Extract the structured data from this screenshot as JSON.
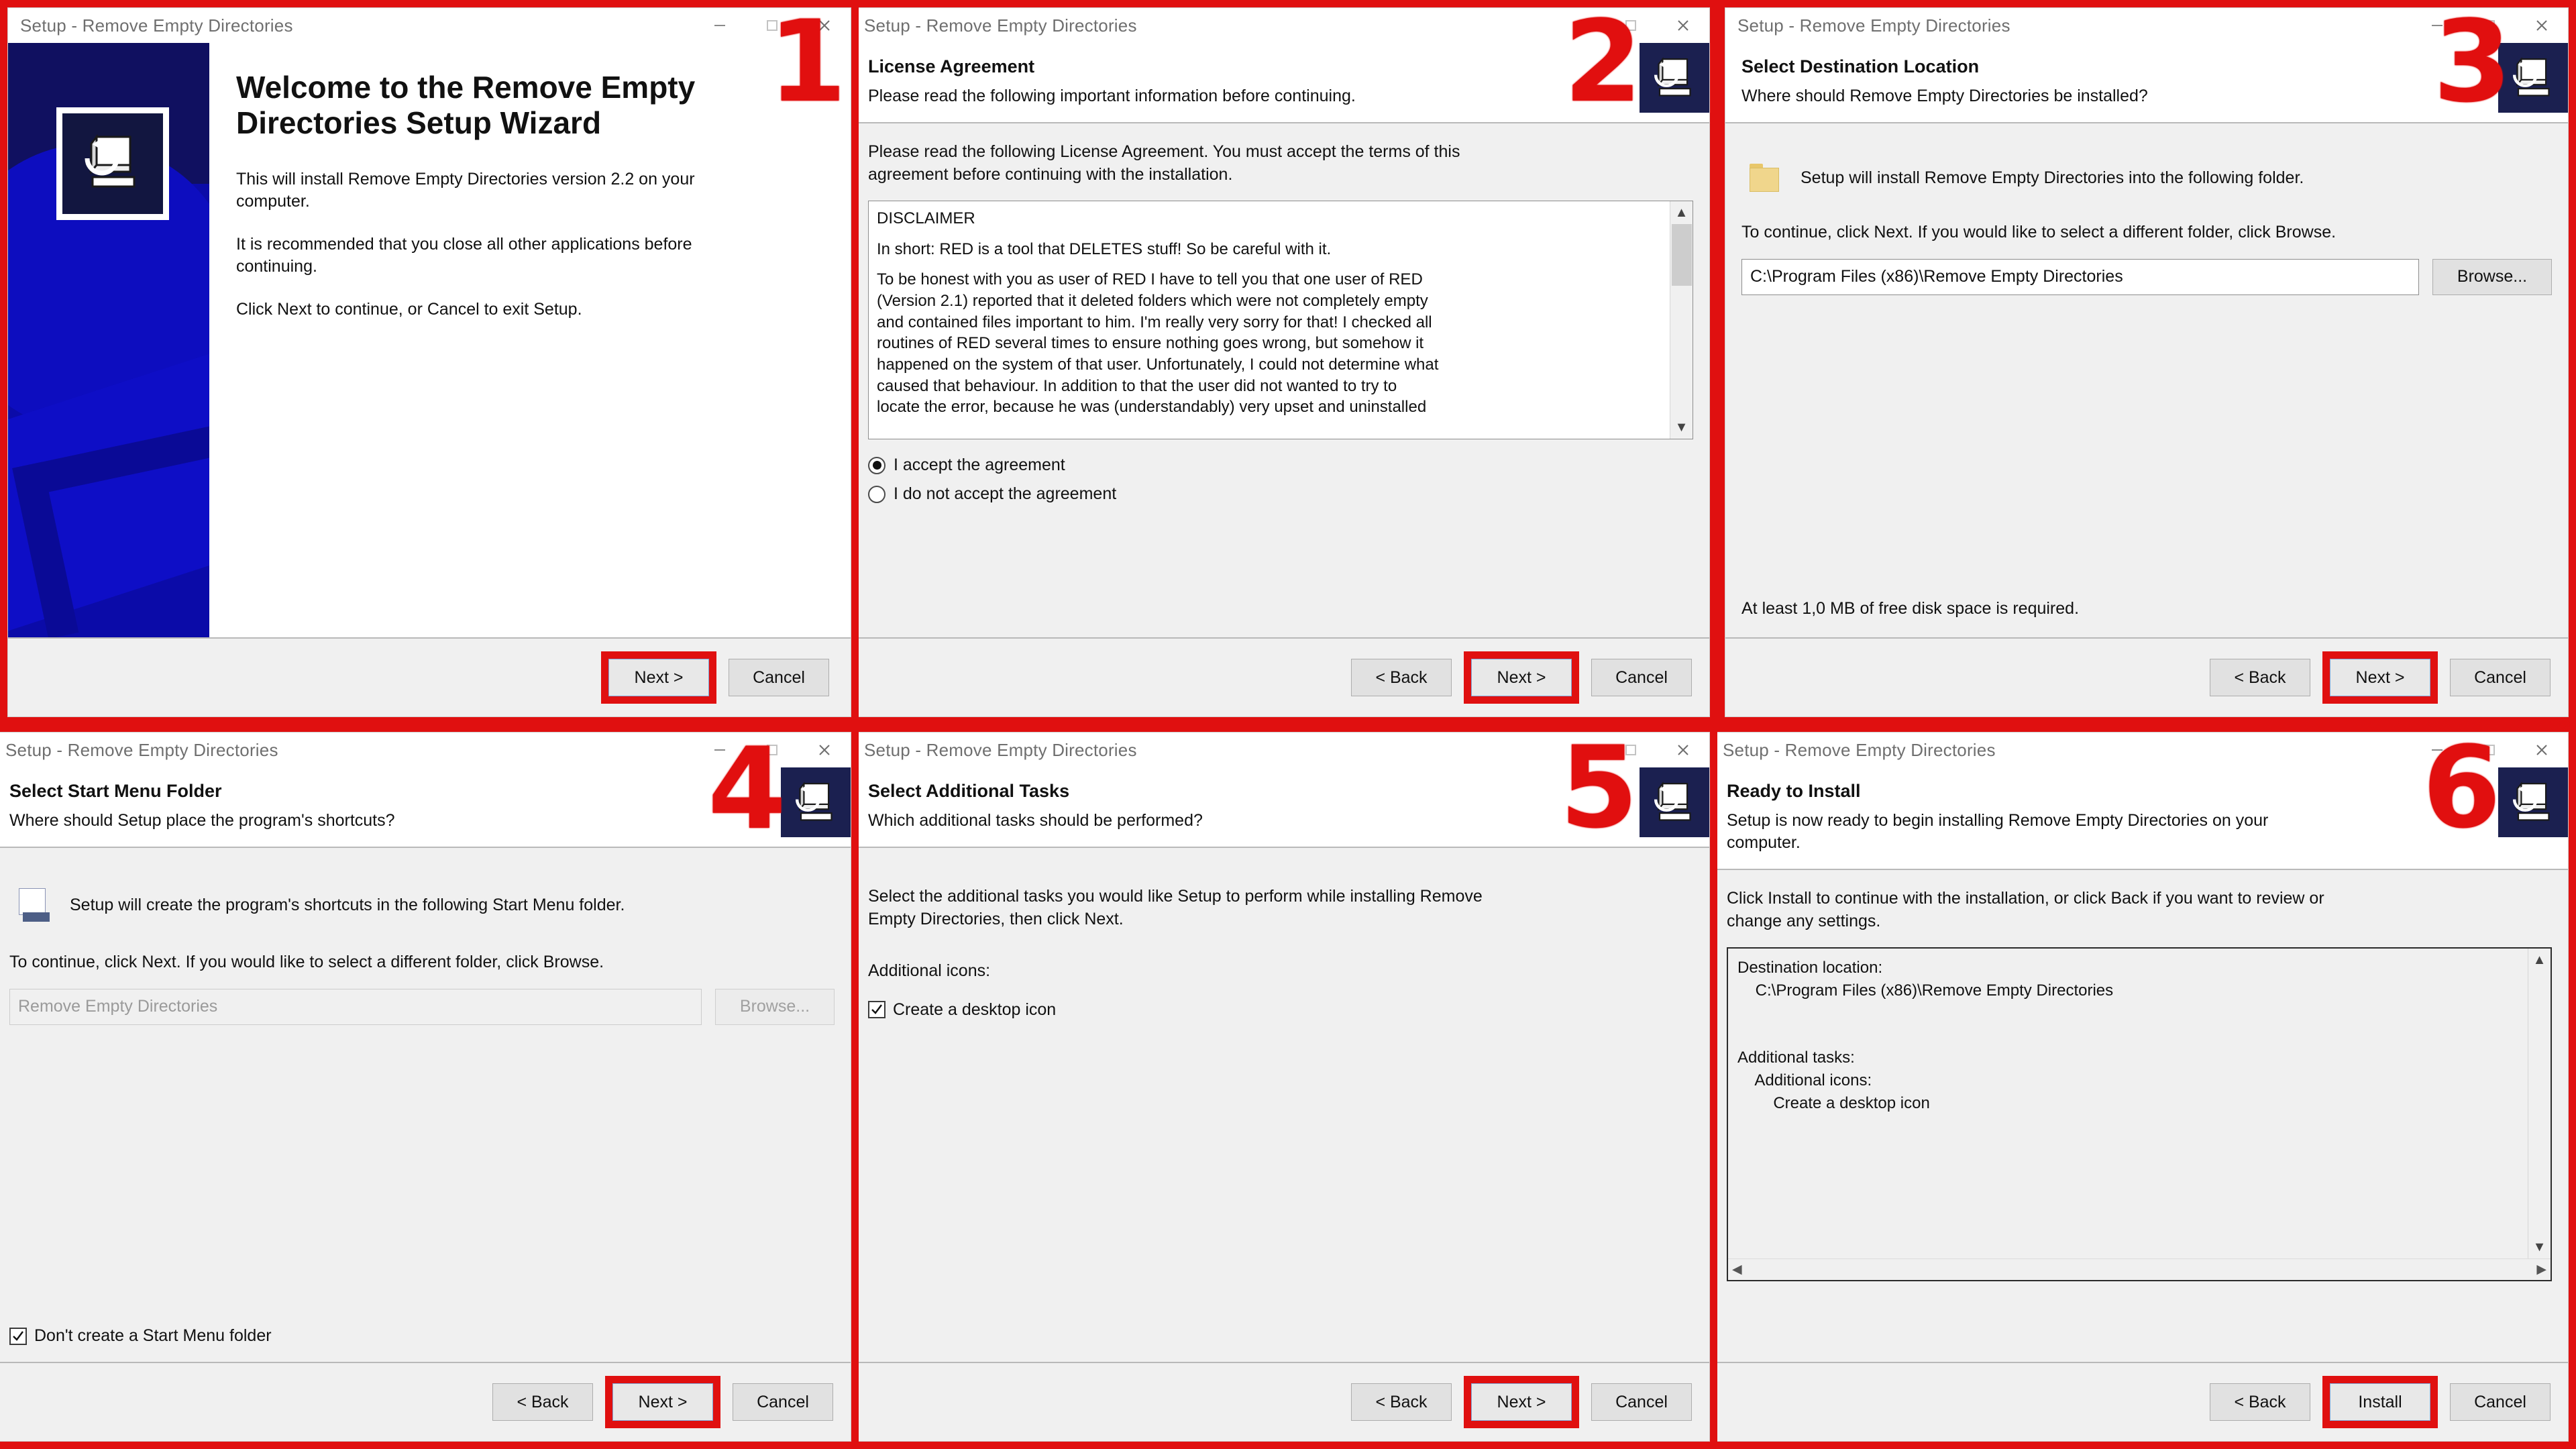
{
  "window": {
    "title": "Setup - Remove Empty Directories",
    "minimize_icon": "minimize-icon",
    "maximize_icon": "maximize-icon",
    "close_icon": "close-icon"
  },
  "buttons": {
    "back": "< Back",
    "next": "Next >",
    "cancel": "Cancel",
    "install": "Install",
    "browse": "Browse..."
  },
  "colors": {
    "highlight": "#e01010",
    "wizard_blue": "#0b0ba8",
    "header_icon_bg": "#1b2050"
  },
  "steps": [
    {
      "number": "1",
      "name": "welcome",
      "heading": "Welcome to the Remove Empty Directories Setup Wizard",
      "paragraphs": [
        "This will install Remove Empty Directories version 2.2 on your computer.",
        "It is recommended that you close all other applications before continuing.",
        "Click Next to continue, or Cancel to exit Setup."
      ],
      "footer_buttons": [
        "Next >",
        "Cancel"
      ],
      "highlighted_button": "Next >"
    },
    {
      "number": "2",
      "name": "license-agreement",
      "heading": "License Agreement",
      "subheading": "Please read the following important information before continuing.",
      "intro": "Please read the following License Agreement. You must accept the terms of this agreement before continuing with the installation.",
      "license_lines": [
        "DISCLAIMER",
        "",
        "In short: RED is a tool that DELETES stuff! So be careful with it.",
        "",
        "To be honest with you as user of RED I have to tell you that one user of RED",
        "(Version 2.1) reported that it deleted folders which were not completely empty",
        "and contained files important to him. I'm really very sorry for that! I checked all",
        "routines of RED several times to ensure nothing goes wrong, but somehow it",
        "happened on the system of that user. Unfortunately, I could not determine what",
        "caused that behaviour. In addition to that the user did not wanted to try to",
        "locate the error, because he was (understandably) very upset and uninstalled"
      ],
      "radios": [
        {
          "label": "I accept the agreement",
          "selected": true
        },
        {
          "label": "I do not accept the agreement",
          "selected": false
        }
      ],
      "footer_buttons": [
        "< Back",
        "Next >",
        "Cancel"
      ],
      "highlighted_button": "Next >"
    },
    {
      "number": "3",
      "name": "select-destination-location",
      "heading": "Select Destination Location",
      "subheading": "Where should Remove Empty Directories be installed?",
      "folder_note": "Setup will install Remove Empty Directories into the following folder.",
      "continue_note": "To continue, click Next. If you would like to select a different folder, click Browse.",
      "path_value": "C:\\Program Files (x86)\\Remove Empty Directories",
      "browse_label": "Browse...",
      "disk_note": "At least 1,0 MB of free disk space is required.",
      "footer_buttons": [
        "< Back",
        "Next >",
        "Cancel"
      ],
      "highlighted_button": "Next >"
    },
    {
      "number": "4",
      "name": "select-start-menu-folder",
      "heading": "Select Start Menu Folder",
      "subheading": "Where should Setup place the program's shortcuts?",
      "folder_note": "Setup will create the program's shortcuts in the following Start Menu folder.",
      "continue_note": "To continue, click Next. If you would like to select a different folder, click Browse.",
      "folder_value": "Remove Empty Directories",
      "browse_label": "Browse...",
      "checkbox": {
        "label": "Don't create a Start Menu folder",
        "checked": true
      },
      "footer_buttons": [
        "< Back",
        "Next >",
        "Cancel"
      ],
      "highlighted_button": "Next >"
    },
    {
      "number": "5",
      "name": "select-additional-tasks",
      "heading": "Select Additional Tasks",
      "subheading": "Which additional tasks should be performed?",
      "intro": "Select the additional tasks you would like Setup to perform while installing Remove Empty Directories, then click Next.",
      "group_label": "Additional icons:",
      "checkbox": {
        "label": "Create a desktop icon",
        "checked": true
      },
      "footer_buttons": [
        "< Back",
        "Next >",
        "Cancel"
      ],
      "highlighted_button": "Next >"
    },
    {
      "number": "6",
      "name": "ready-to-install",
      "heading": "Ready to Install",
      "subheading": "Setup is now ready to begin installing Remove Empty Directories on your computer.",
      "intro": "Click Install to continue with the installation, or click Back if you want to review or change any settings.",
      "summary_lines": [
        "Destination location:",
        "    C:\\Program Files (x86)\\Remove Empty Directories",
        "",
        "",
        "Additional tasks:",
        "    Additional icons:",
        "        Create a desktop icon"
      ],
      "footer_buttons": [
        "< Back",
        "Install",
        "Cancel"
      ],
      "highlighted_button": "Install"
    }
  ]
}
